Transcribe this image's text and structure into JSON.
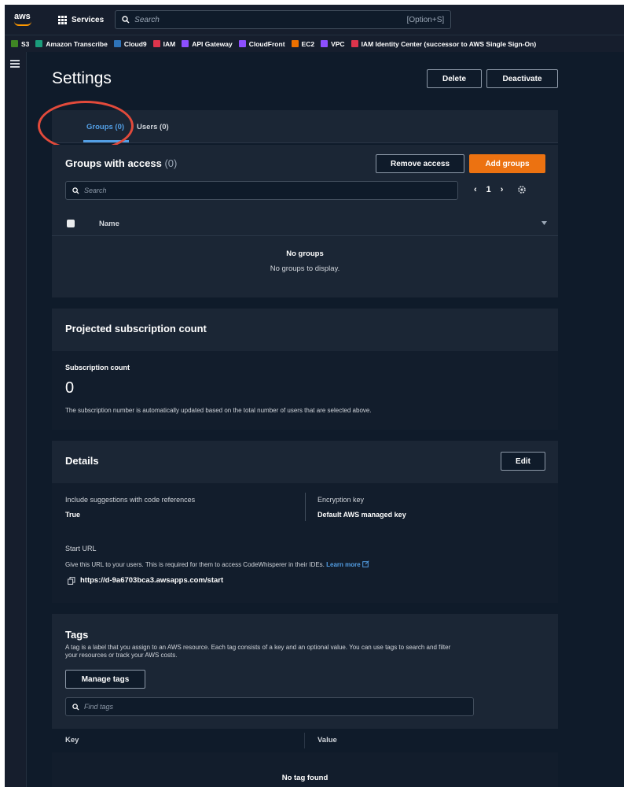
{
  "nav": {
    "logo_text": "aws",
    "services_label": "Services",
    "search_placeholder": "Search",
    "search_shortcut": "[Option+S]"
  },
  "favorites": [
    {
      "label": "S3",
      "color": "#3f8624"
    },
    {
      "label": "Amazon Transcribe",
      "color": "#1a9c7b"
    },
    {
      "label": "Cloud9",
      "color": "#2e73b8"
    },
    {
      "label": "IAM",
      "color": "#dd344c"
    },
    {
      "label": "API Gateway",
      "color": "#8c4fff"
    },
    {
      "label": "CloudFront",
      "color": "#8c4fff"
    },
    {
      "label": "EC2",
      "color": "#ed7100"
    },
    {
      "label": "VPC",
      "color": "#8c4fff"
    },
    {
      "label": "IAM Identity Center (successor to AWS Single Sign-On)",
      "color": "#dd344c"
    }
  ],
  "page": {
    "title": "Settings",
    "delete_label": "Delete",
    "deactivate_label": "Deactivate"
  },
  "tabs": {
    "groups_label": "Groups (0)",
    "users_label": "Users (0)"
  },
  "groups": {
    "title": "Groups with access",
    "count": "(0)",
    "remove_label": "Remove access",
    "add_label": "Add groups",
    "search_placeholder": "Search",
    "page_number": "1",
    "col_name": "Name",
    "empty_title": "No groups",
    "empty_desc": "No groups to display."
  },
  "subscription": {
    "title": "Projected subscription count",
    "label": "Subscription count",
    "value": "0",
    "desc": "The subscription number is automatically updated based on the total number of users that are selected above."
  },
  "details": {
    "title": "Details",
    "edit_label": "Edit",
    "suggestions_label": "Include suggestions with code references",
    "suggestions_value": "True",
    "encryption_label": "Encryption key",
    "encryption_value": "Default AWS managed key",
    "start_url_label": "Start URL",
    "start_url_desc": "Give this URL to your users. This is required for them to access CodeWhisperer in their IDEs.",
    "learn_more": "Learn more",
    "start_url_value": "https://d-9a6703bca3.awsapps.com/start"
  },
  "tags": {
    "title": "Tags",
    "desc_line1": "A tag is a label that you assign to an AWS resource. Each tag consists of a key and an optional value. You can use tags to search and filter",
    "desc_line2": "your resources or track your AWS costs.",
    "manage_label": "Manage tags",
    "search_placeholder": "Find tags",
    "col_key": "Key",
    "col_value": "Value",
    "empty_title": "No tag found"
  },
  "colors": {
    "accent": "#539fe5",
    "primary_button": "#ec7211",
    "highlight_ring": "#e24a3b"
  }
}
